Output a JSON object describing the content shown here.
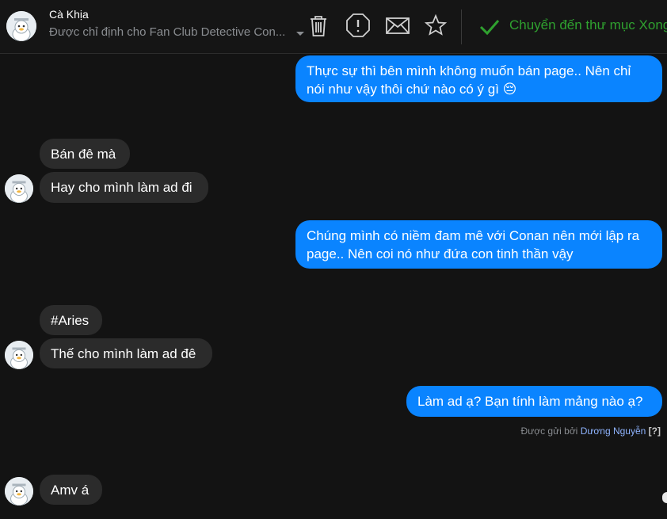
{
  "header": {
    "contact_name": "Cà Khịa",
    "assigned_to": "Được chỉ định cho Fan Club Detective Con...",
    "actions": [
      {
        "icon": "trash-icon"
      },
      {
        "icon": "report-icon"
      },
      {
        "icon": "envelope-icon"
      },
      {
        "icon": "star-icon"
      }
    ],
    "move_done_label": "Chuyển đến thư mục Xong"
  },
  "messages": {
    "m1": "Thực sự thì bên mình không muốn bán page.. Nên chỉ nói như vậy thôi chứ nào có ý gì 😔",
    "m2": "Bán đê mà",
    "m3": "Hay cho mình làm ad đi",
    "m4": "Chúng mình có niềm đam mê với Conan nên mới lập ra page.. Nên coi nó như đứa con tinh thần vậy",
    "m5": "#Aries",
    "m6": "Thế cho mình làm ad đê",
    "m7": "Làm ad ạ? Bạn tính làm mảng nào ạ?",
    "m8": "Amv á"
  },
  "sent_by": {
    "prefix": "Được gửi bởi",
    "name": "Dương Nguyễn",
    "help": "[?]"
  },
  "colors": {
    "background": "#131313",
    "incoming_bubble": "#2b2b2b",
    "outgoing_bubble": "#0a84ff",
    "done_green": "#2fa12f"
  }
}
